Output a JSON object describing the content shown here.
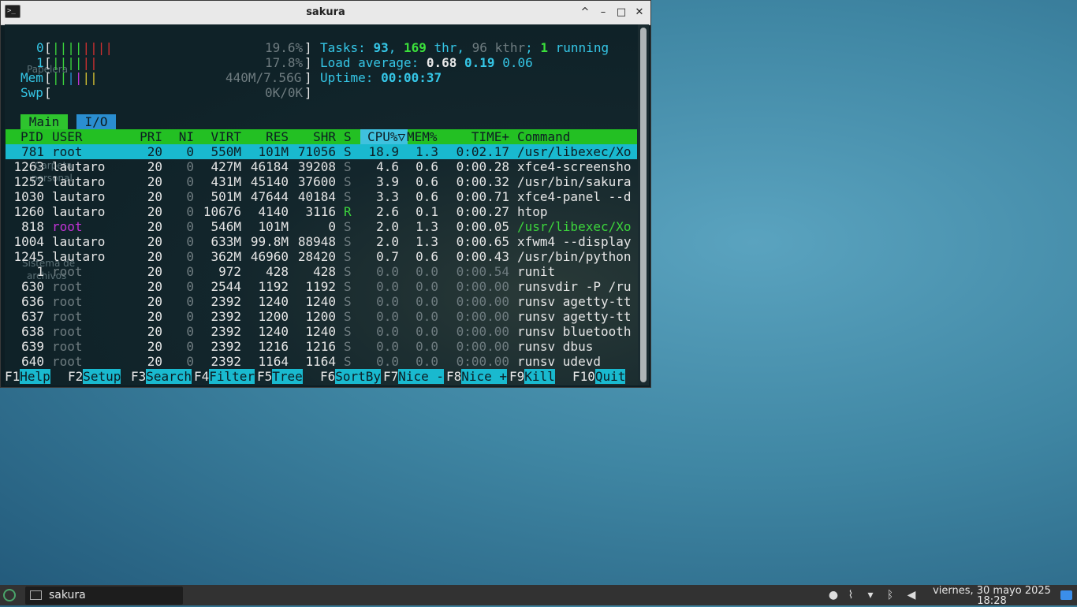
{
  "window": {
    "title": "sakura",
    "controls": {
      "shade": "^",
      "minimize": "–",
      "maximize": "□",
      "close": "✕"
    }
  },
  "meters": {
    "cpu0": {
      "label": "0",
      "bars": "||||||||",
      "value": "19.6%"
    },
    "cpu1": {
      "label": "1",
      "bars": "||||||",
      "value": "17.8%"
    },
    "mem": {
      "label": "Mem",
      "bars": "||||||",
      "value": "440M/7.56G"
    },
    "swp": {
      "label": "Swp",
      "bars": "",
      "value": "0K/0K"
    }
  },
  "stats": {
    "tasks_label": "Tasks: ",
    "tasks": "93",
    "sep1": ", ",
    "thr": "169",
    "thr_label": " thr, ",
    "kthr": "96 kthr",
    "sep2": "; ",
    "running": "1",
    "running_label": " running",
    "load_label": "Load average: ",
    "load1": "0.68",
    "load5": "0.19",
    "load15": "0.06",
    "uptime_label": "Uptime: ",
    "uptime": "00:00:37"
  },
  "tabs": [
    {
      "label": "Main"
    },
    {
      "label": "I/O"
    }
  ],
  "columns": [
    "PID",
    "USER",
    "PRI",
    "NI",
    "VIRT",
    "RES",
    "SHR",
    "S",
    "CPU%▽",
    "MEM%",
    "TIME+",
    "Command"
  ],
  "processes": [
    {
      "pid": "781",
      "user": "root",
      "pri": "20",
      "ni": "0",
      "virt": "550M",
      "res": "101M",
      "shr": "71056",
      "s": "S",
      "cpu": "18.9",
      "mem": "1.3",
      "time": "0:02.17",
      "cmd": "/usr/libexec/Xo"
    },
    {
      "pid": "1263",
      "user": "lautaro",
      "pri": "20",
      "ni": "0",
      "virt": "427M",
      "res": "46184",
      "shr": "39208",
      "s": "S",
      "cpu": "4.6",
      "mem": "0.6",
      "time": "0:00.28",
      "cmd": "xfce4-screensho"
    },
    {
      "pid": "1252",
      "user": "lautaro",
      "pri": "20",
      "ni": "0",
      "virt": "431M",
      "res": "45140",
      "shr": "37600",
      "s": "S",
      "cpu": "3.9",
      "mem": "0.6",
      "time": "0:00.32",
      "cmd": "/usr/bin/sakura"
    },
    {
      "pid": "1030",
      "user": "lautaro",
      "pri": "20",
      "ni": "0",
      "virt": "501M",
      "res": "47644",
      "shr": "40184",
      "s": "S",
      "cpu": "3.3",
      "mem": "0.6",
      "time": "0:00.71",
      "cmd": "xfce4-panel --d"
    },
    {
      "pid": "1260",
      "user": "lautaro",
      "pri": "20",
      "ni": "0",
      "virt": "10676",
      "res": "4140",
      "shr": "3116",
      "s": "R",
      "cpu": "2.6",
      "mem": "0.1",
      "time": "0:00.27",
      "cmd": "htop"
    },
    {
      "pid": "818",
      "user": "root",
      "pri": "20",
      "ni": "0",
      "virt": "546M",
      "res": "101M",
      "shr": "0",
      "s": "S",
      "cpu": "2.0",
      "mem": "1.3",
      "time": "0:00.05",
      "cmd": "/usr/libexec/Xo"
    },
    {
      "pid": "1004",
      "user": "lautaro",
      "pri": "20",
      "ni": "0",
      "virt": "633M",
      "res": "99.8M",
      "shr": "88948",
      "s": "S",
      "cpu": "2.0",
      "mem": "1.3",
      "time": "0:00.65",
      "cmd": "xfwm4 --display"
    },
    {
      "pid": "1245",
      "user": "lautaro",
      "pri": "20",
      "ni": "0",
      "virt": "362M",
      "res": "46960",
      "shr": "28420",
      "s": "S",
      "cpu": "0.7",
      "mem": "0.6",
      "time": "0:00.43",
      "cmd": "/usr/bin/python"
    },
    {
      "pid": "1",
      "user": "root",
      "pri": "20",
      "ni": "0",
      "virt": "972",
      "res": "428",
      "shr": "428",
      "s": "S",
      "cpu": "0.0",
      "mem": "0.0",
      "time": "0:00.54",
      "cmd": "runit"
    },
    {
      "pid": "630",
      "user": "root",
      "pri": "20",
      "ni": "0",
      "virt": "2544",
      "res": "1192",
      "shr": "1192",
      "s": "S",
      "cpu": "0.0",
      "mem": "0.0",
      "time": "0:00.00",
      "cmd": "runsvdir -P /ru"
    },
    {
      "pid": "636",
      "user": "root",
      "pri": "20",
      "ni": "0",
      "virt": "2392",
      "res": "1240",
      "shr": "1240",
      "s": "S",
      "cpu": "0.0",
      "mem": "0.0",
      "time": "0:00.00",
      "cmd": "runsv agetty-tt"
    },
    {
      "pid": "637",
      "user": "root",
      "pri": "20",
      "ni": "0",
      "virt": "2392",
      "res": "1200",
      "shr": "1200",
      "s": "S",
      "cpu": "0.0",
      "mem": "0.0",
      "time": "0:00.00",
      "cmd": "runsv agetty-tt"
    },
    {
      "pid": "638",
      "user": "root",
      "pri": "20",
      "ni": "0",
      "virt": "2392",
      "res": "1240",
      "shr": "1240",
      "s": "S",
      "cpu": "0.0",
      "mem": "0.0",
      "time": "0:00.00",
      "cmd": "runsv bluetooth"
    },
    {
      "pid": "639",
      "user": "root",
      "pri": "20",
      "ni": "0",
      "virt": "2392",
      "res": "1216",
      "shr": "1216",
      "s": "S",
      "cpu": "0.0",
      "mem": "0.0",
      "time": "0:00.00",
      "cmd": "runsv dbus"
    },
    {
      "pid": "640",
      "user": "root",
      "pri": "20",
      "ni": "0",
      "virt": "2392",
      "res": "1164",
      "shr": "1164",
      "s": "S",
      "cpu": "0.0",
      "mem": "0.0",
      "time": "0:00.00",
      "cmd": "runsv udevd"
    }
  ],
  "fkeys": [
    {
      "key": "F1",
      "label": "Help  "
    },
    {
      "key": "F2",
      "label": "Setup "
    },
    {
      "key": "F3",
      "label": "Search"
    },
    {
      "key": "F4",
      "label": "Filter"
    },
    {
      "key": "F5",
      "label": "Tree  "
    },
    {
      "key": "F6",
      "label": "SortBy"
    },
    {
      "key": "F7",
      "label": "Nice -"
    },
    {
      "key": "F8",
      "label": "Nice +"
    },
    {
      "key": "F9",
      "label": "Kill  "
    },
    {
      "key": "F10",
      "label": "Quit  "
    }
  ],
  "desktop_ghosts": {
    "trash": "Papelera",
    "home": "Carpeta",
    "home2": "personal",
    "fs": "Sistema de",
    "fs2": "archivos"
  },
  "taskbar": {
    "task_label": "sakura",
    "tray_icons": [
      "screenshot-icon",
      "paperclip-icon",
      "wifi-icon",
      "bluetooth-icon",
      "volume-icon"
    ],
    "clock_date": "viernes, 30 mayo 2025",
    "clock_time": "18:28"
  },
  "colors": {
    "accent_green": "#23c023",
    "accent_cyan": "#19b9cf",
    "tab_io_blue": "#2a8ed0"
  }
}
